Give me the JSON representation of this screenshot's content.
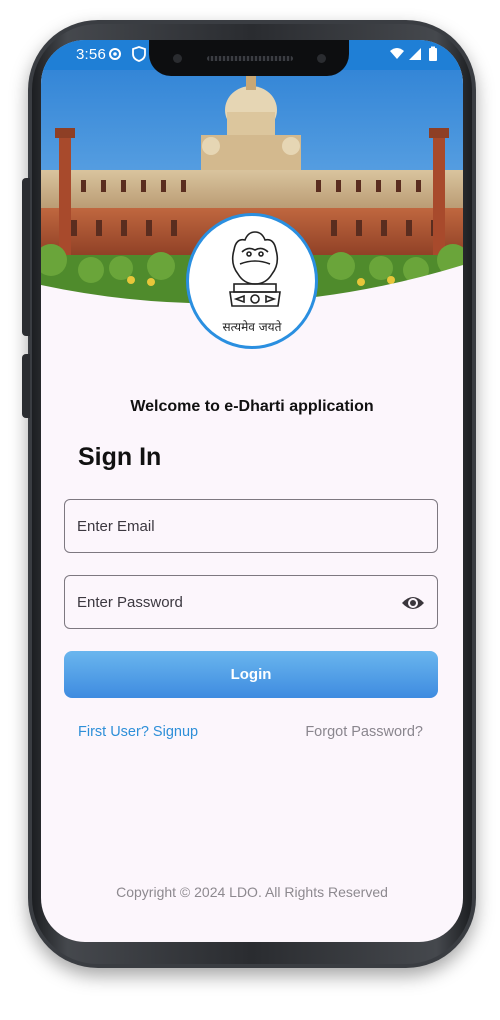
{
  "status_bar": {
    "time": "3:56",
    "icons": [
      "gear-icon",
      "shield-icon",
      "wifi-icon",
      "signal-icon",
      "battery-icon"
    ]
  },
  "hero": {
    "image": "government-building-photo",
    "emblem": "national-emblem",
    "emblem_motto": "सत्यमेव जयते"
  },
  "welcome_text": "Welcome to e-Dharti application",
  "title": "Sign In",
  "form": {
    "email_placeholder": "Enter Email",
    "email_value": "",
    "password_placeholder": "Enter Password",
    "password_value": "",
    "visibility_icon": "eye-icon"
  },
  "login_button_label": "Login",
  "links": {
    "signup": "First User? Signup",
    "forgot_password": "Forgot Password?"
  },
  "footer": {
    "copyright": "Copyright © 2024 LDO. All Rights Reserved"
  },
  "colors": {
    "status_bar": "#1f7fd6",
    "accent": "#2e8fd8",
    "button_top": "#6ab6ee",
    "button_bottom": "#3e8be0",
    "screen_bg": "#fcf6fc"
  }
}
